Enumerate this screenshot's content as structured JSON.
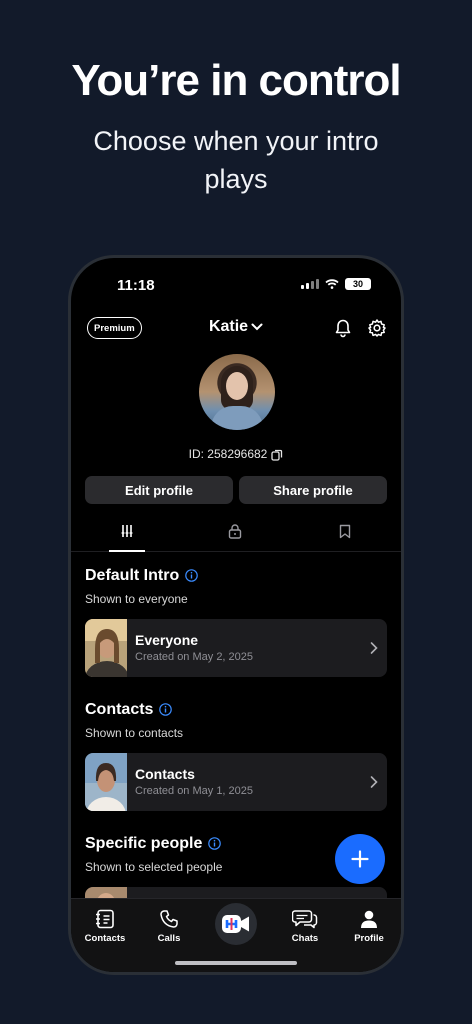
{
  "promo": {
    "headline": "You’re in control",
    "subline": "Choose when your intro plays"
  },
  "status_bar": {
    "time": "11:18",
    "battery": "30",
    "icons": [
      "signal-icon",
      "wifi-icon",
      "battery-icon"
    ]
  },
  "header": {
    "premium_label": "Premium",
    "username": "Katie",
    "icons": [
      "chevron-down-icon",
      "bell-icon",
      "gear-icon"
    ]
  },
  "profile": {
    "id_text": "ID: 258296682",
    "edit_label": "Edit profile",
    "share_label": "Share profile"
  },
  "tabs": [
    {
      "icon": "intros-icon",
      "active": true
    },
    {
      "icon": "lock-icon",
      "active": false
    },
    {
      "icon": "bookmark-icon",
      "active": false
    }
  ],
  "sections": [
    {
      "title": "Default Intro",
      "subtitle": "Shown to everyone",
      "card": {
        "title": "Everyone",
        "date": "Created on May 2, 2025"
      }
    },
    {
      "title": "Contacts",
      "subtitle": "Shown to contacts",
      "card": {
        "title": "Contacts",
        "date": "Created on May 1, 2025"
      }
    },
    {
      "title": "Specific people",
      "subtitle": "Shown to selected people"
    }
  ],
  "bottom_nav": {
    "items": [
      {
        "label": "Contacts",
        "icon": "contacts-icon"
      },
      {
        "label": "Calls",
        "icon": "phone-icon"
      },
      {
        "label": "",
        "icon": "video-logo-icon"
      },
      {
        "label": "Chats",
        "icon": "chat-icon"
      },
      {
        "label": "Profile",
        "icon": "person-icon"
      }
    ]
  },
  "colors": {
    "background": "#121a2a",
    "accent": "#1a6cff",
    "info": "#3b8cff",
    "card": "#1c1c1f"
  }
}
